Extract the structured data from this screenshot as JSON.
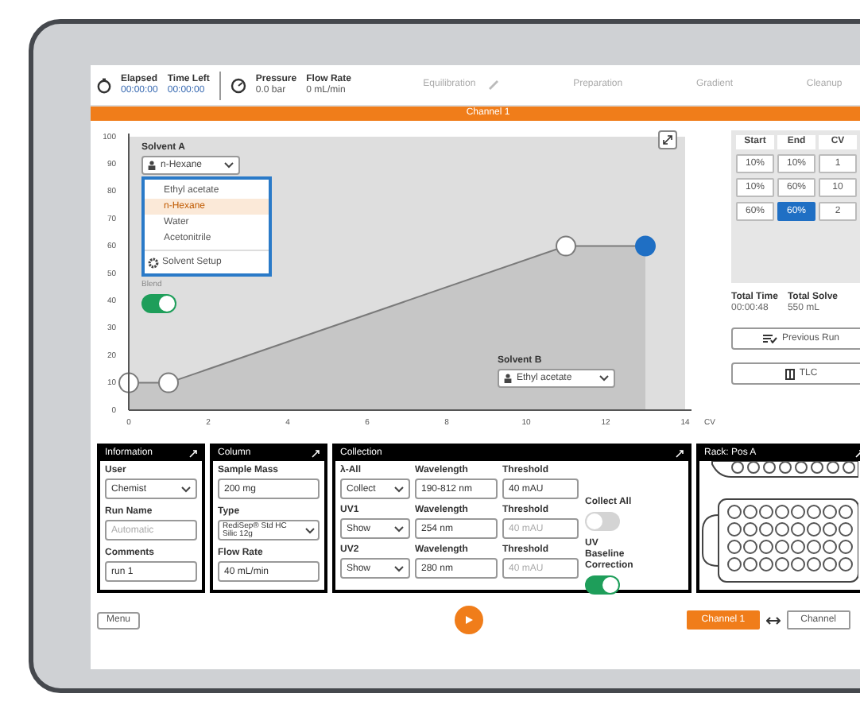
{
  "header": {
    "timers": [
      {
        "label": "Elapsed",
        "value": "00:00:00"
      },
      {
        "label": "Time Left",
        "value": "00:00:00"
      }
    ],
    "readings": [
      {
        "label": "Pressure",
        "value": "0.0 bar"
      },
      {
        "label": "Flow Rate",
        "value": "0 mL/min"
      }
    ],
    "steps": [
      "Equilibration",
      "Preparation",
      "Gradient",
      "Cleanup"
    ]
  },
  "channel_bar": "Channel 1",
  "gradient": {
    "solvent_a": {
      "label": "Solvent A",
      "value": "n-Hexane",
      "expanded": true,
      "options": [
        {
          "label": "Ethyl acetate",
          "selected": false
        },
        {
          "label": "n-Hexane",
          "selected": true
        },
        {
          "label": "Water",
          "selected": false
        },
        {
          "label": "Acetonitrile",
          "selected": false
        }
      ],
      "setup": "Solvent Setup"
    },
    "blend": {
      "label": "Blend",
      "on": true
    },
    "solvent_b": {
      "label": "Solvent B",
      "value": "Ethyl acetate"
    },
    "chart_data": {
      "type": "area",
      "xlabel": "CV",
      "x": [
        0,
        1,
        11,
        13
      ],
      "series": [
        {
          "color": "#7a7a7a",
          "marker": "circle",
          "values": [
            10,
            10,
            60,
            60
          ]
        }
      ],
      "xlim": [
        0,
        14
      ],
      "ylim": [
        0,
        100
      ],
      "xticks": [
        0,
        2,
        4,
        6,
        8,
        10,
        12,
        14
      ],
      "yticks": [
        0,
        10,
        20,
        30,
        40,
        50,
        60,
        70,
        80,
        90,
        100
      ]
    }
  },
  "segments": {
    "columns": [
      "Start",
      "End",
      "CV"
    ],
    "rows": [
      {
        "cells": [
          {
            "text": "10%",
            "selected": false
          },
          {
            "text": "10%",
            "selected": false
          },
          {
            "text": "1",
            "selected": false
          }
        ]
      },
      {
        "cells": [
          {
            "text": "10%",
            "selected": false
          },
          {
            "text": "60%",
            "selected": false
          },
          {
            "text": "10",
            "selected": false
          }
        ]
      },
      {
        "cells": [
          {
            "text": "60%",
            "selected": false
          },
          {
            "text": "60%",
            "selected": true
          },
          {
            "text": "2",
            "selected": false
          }
        ]
      }
    ]
  },
  "totals": [
    {
      "label": "Total Time",
      "value": "00:00:48"
    },
    {
      "label": "Total Solve",
      "value": "550 mL"
    }
  ],
  "buttons": [
    {
      "kind": "runs",
      "label": "Previous Run"
    },
    {
      "kind": "tlc",
      "label": "TLC"
    }
  ],
  "information": {
    "title": "Information",
    "user": {
      "label": "User",
      "value": "Chemist"
    },
    "run_name": {
      "label": "Run Name",
      "placeholder": "Automatic"
    },
    "comments": {
      "label": "Comments",
      "value": "run 1"
    }
  },
  "column": {
    "title": "Column",
    "sample_mass": {
      "label": "Sample Mass",
      "value": "200 mg"
    },
    "type": {
      "label": "Type",
      "value": "RediSep® Std HC Silic 12g"
    },
    "flow_rate": {
      "label": "Flow Rate",
      "value": "40 mL/min"
    }
  },
  "collection": {
    "title": "Collection",
    "rows": [
      {
        "label": "λ-All",
        "mode": "Collect",
        "wavelength_label": "Wavelength",
        "wavelength": "190-812 nm",
        "threshold_label": "Threshold",
        "threshold": "40 mAU",
        "disabled": false
      },
      {
        "label": "UV1",
        "mode": "Show",
        "wavelength_label": "Wavelength",
        "wavelength": "254 nm",
        "threshold_label": "Threshold",
        "threshold": "40 mAU",
        "disabled": true
      },
      {
        "label": "UV2",
        "mode": "Show",
        "wavelength_label": "Wavelength",
        "wavelength": "280 nm",
        "threshold_label": "Threshold",
        "threshold": "40 mAU",
        "disabled": true
      }
    ],
    "collect_all": {
      "label": "Collect All",
      "on": false
    },
    "baseline": {
      "label": "UV Baseline Correction",
      "on": true
    }
  },
  "rack": {
    "title": "Rack: Pos A"
  },
  "footer": {
    "menu": "Menu",
    "channels": [
      {
        "label": "Channel 1",
        "selected": true
      },
      {
        "label": "Channel",
        "selected": false
      }
    ]
  }
}
